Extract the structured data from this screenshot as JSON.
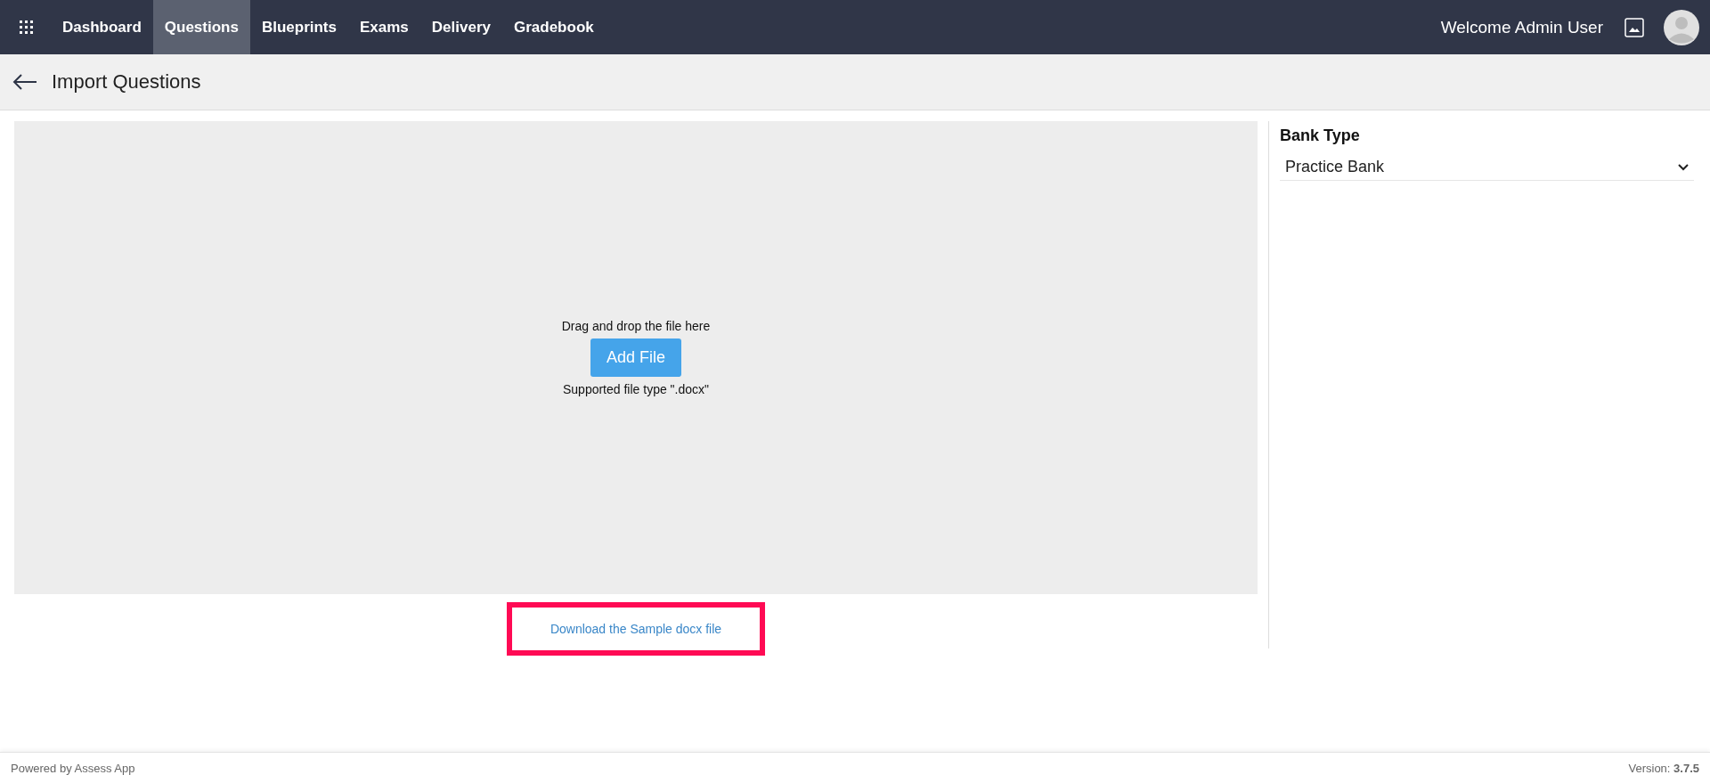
{
  "nav": {
    "items": [
      {
        "label": "Dashboard",
        "selected": false
      },
      {
        "label": "Questions",
        "selected": true
      },
      {
        "label": "Blueprints",
        "selected": false
      },
      {
        "label": "Exams",
        "selected": false
      },
      {
        "label": "Delivery",
        "selected": false
      },
      {
        "label": "Gradebook",
        "selected": false
      }
    ],
    "welcome": "Welcome Admin User"
  },
  "page_header": {
    "title": "Import Questions"
  },
  "dropzone": {
    "hint": "Drag and drop the file here",
    "button": "Add File",
    "supported": "Supported file type \".docx\""
  },
  "download_link": {
    "label": "Download the Sample docx file",
    "highlighted": true
  },
  "bank_type": {
    "label": "Bank Type",
    "value": "Practice Bank"
  },
  "footer": {
    "left": "Powered by Assess App",
    "right": "Version: **3.7.5**"
  }
}
